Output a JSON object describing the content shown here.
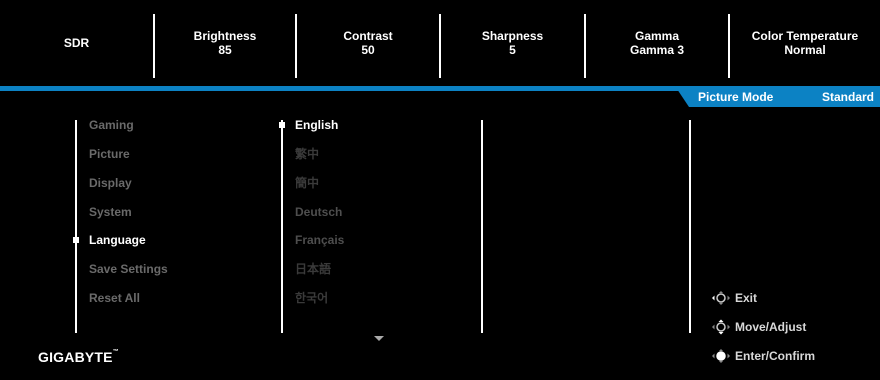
{
  "top_stats": [
    {
      "label": "SDR",
      "value": ""
    },
    {
      "label": "Brightness",
      "value": "85"
    },
    {
      "label": "Contrast",
      "value": "50"
    },
    {
      "label": "Sharpness",
      "value": "5"
    },
    {
      "label": "Gamma",
      "value": "Gamma 3"
    },
    {
      "label": "Color Temperature",
      "value": "Normal"
    }
  ],
  "picture_mode": {
    "label": "Picture Mode",
    "value": "Standard"
  },
  "main_menu": [
    "Gaming",
    "Picture",
    "Display",
    "System",
    "Language",
    "Save Settings",
    "Reset All"
  ],
  "main_menu_selected": "Language",
  "languages": [
    "English",
    "繁中",
    "簡中",
    "Deutsch",
    "Français",
    "日本語",
    "한국어"
  ],
  "language_selected": "English",
  "help": {
    "exit": "Exit",
    "move": "Move/Adjust",
    "confirm": "Enter/Confirm"
  },
  "brand": "GIGABYTE",
  "colors": {
    "accent": "#0c82c4",
    "dim_text": "#6a6a6a"
  }
}
